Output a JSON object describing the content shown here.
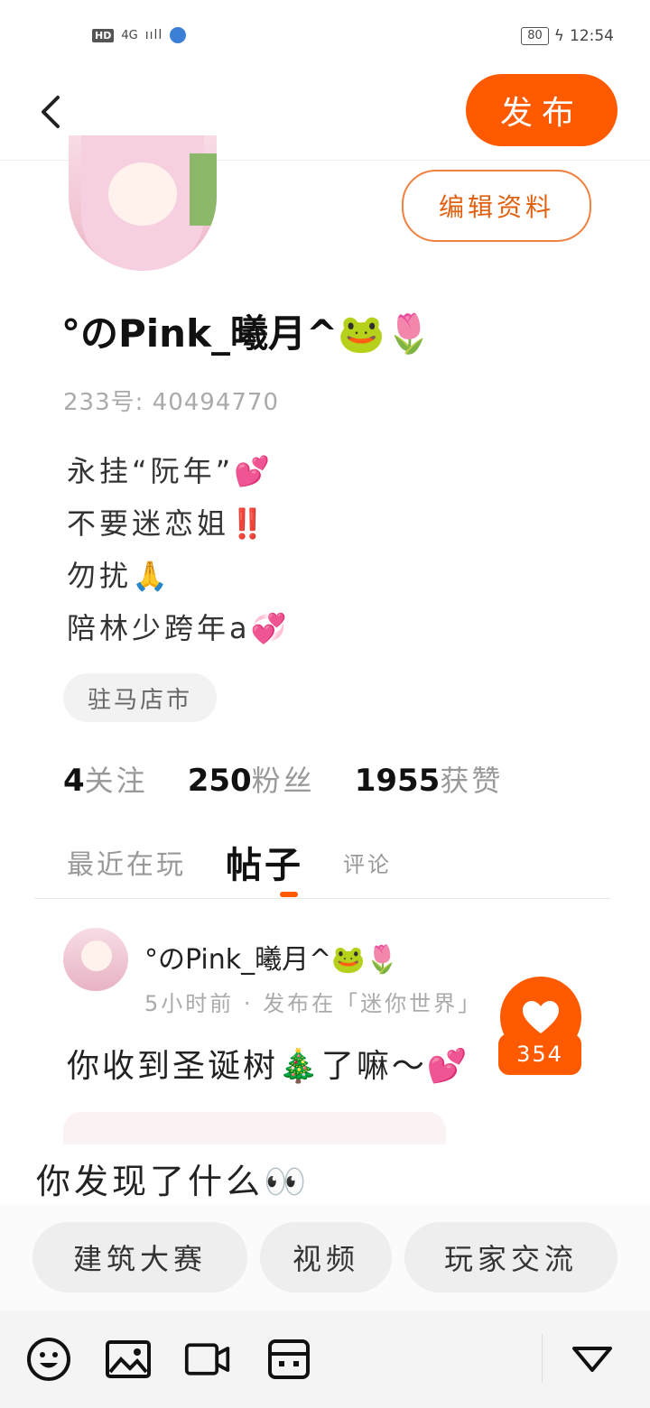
{
  "status_bar": {
    "hd": "HD",
    "network": "4G",
    "signal": "ııll",
    "battery": "80",
    "time": "12:54"
  },
  "header": {
    "publish_label": "发布"
  },
  "profile": {
    "edit_label": "编辑资料",
    "nickname": "°のPink_曦月^🐸🌷",
    "uid": "233号: 40494770",
    "bio": [
      "永挂“阮年”💕",
      "不要迷恋姐‼️",
      "勿扰🙏",
      "陪林少跨年a💞"
    ],
    "location": "驻马店市",
    "stats": [
      {
        "value": "4",
        "label": "关注"
      },
      {
        "value": "250",
        "label": "粉丝"
      },
      {
        "value": "1955",
        "label": "获赞"
      }
    ]
  },
  "tabs": [
    "最近在玩",
    "帖子",
    "评论"
  ],
  "post": {
    "author": "°のPink_曦月^🐸🌷",
    "meta": "5小时前 · 发布在「迷你世界」",
    "text": "你收到圣诞树🎄了嘛～💕",
    "likes": "354"
  },
  "compose": {
    "text": "你发现了什么👀"
  },
  "tags": [
    "建筑大赛",
    "视频",
    "玩家交流"
  ],
  "toolbar_icons": [
    "emoji-icon",
    "image-icon",
    "video-icon",
    "game-icon",
    "collapse-icon"
  ],
  "colors": {
    "accent": "#ff5a00"
  }
}
